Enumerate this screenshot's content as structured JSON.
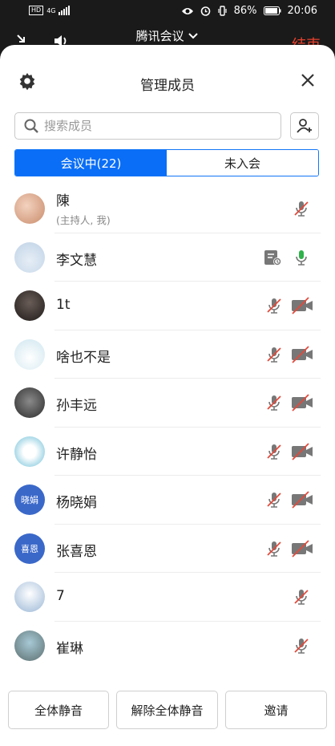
{
  "status_bar": {
    "network": "4G",
    "hd": "HD",
    "battery": "86%",
    "time": "20:06"
  },
  "meeting_bar": {
    "title": "腾讯会议",
    "end_label": "结束"
  },
  "panel": {
    "title": "管理成员",
    "search_placeholder": "搜索成员",
    "tabs": [
      {
        "label": "会议中(22)",
        "active": true
      },
      {
        "label": "未入会",
        "active": false
      }
    ],
    "members": [
      {
        "name": "陳",
        "sub": "(主持人, 我)",
        "avatar_text": "",
        "mic": "muted",
        "camera": "none",
        "sharing": false
      },
      {
        "name": "李文慧",
        "sub": "",
        "avatar_text": "",
        "mic": "on",
        "camera": "none",
        "sharing": true
      },
      {
        "name": "1t",
        "sub": "",
        "avatar_text": "",
        "mic": "muted",
        "camera": "off",
        "sharing": false
      },
      {
        "name": "啥也不是",
        "sub": "",
        "avatar_text": "",
        "mic": "muted",
        "camera": "off",
        "sharing": false
      },
      {
        "name": "孙丰远",
        "sub": "",
        "avatar_text": "",
        "mic": "muted",
        "camera": "off",
        "sharing": false
      },
      {
        "name": "许静怡",
        "sub": "",
        "avatar_text": "",
        "mic": "muted",
        "camera": "off",
        "sharing": false
      },
      {
        "name": "杨晓娟",
        "sub": "",
        "avatar_text": "晓娟",
        "mic": "muted",
        "camera": "off",
        "sharing": false
      },
      {
        "name": "张喜恩",
        "sub": "",
        "avatar_text": "喜恩",
        "mic": "muted",
        "camera": "off",
        "sharing": false
      },
      {
        "name": "7",
        "sub": "",
        "avatar_text": "",
        "mic": "muted",
        "camera": "none",
        "sharing": false
      },
      {
        "name": "崔琳",
        "sub": "",
        "avatar_text": "",
        "mic": "muted",
        "camera": "none",
        "sharing": false
      }
    ],
    "buttons": {
      "mute_all": "全体静音",
      "unmute_all": "解除全体静音",
      "invite": "邀请"
    }
  },
  "colors": {
    "accent": "#0a6ef7",
    "end_red": "#e8402c",
    "mic_on": "#2fb24a",
    "muted_red": "#e24a3b"
  }
}
